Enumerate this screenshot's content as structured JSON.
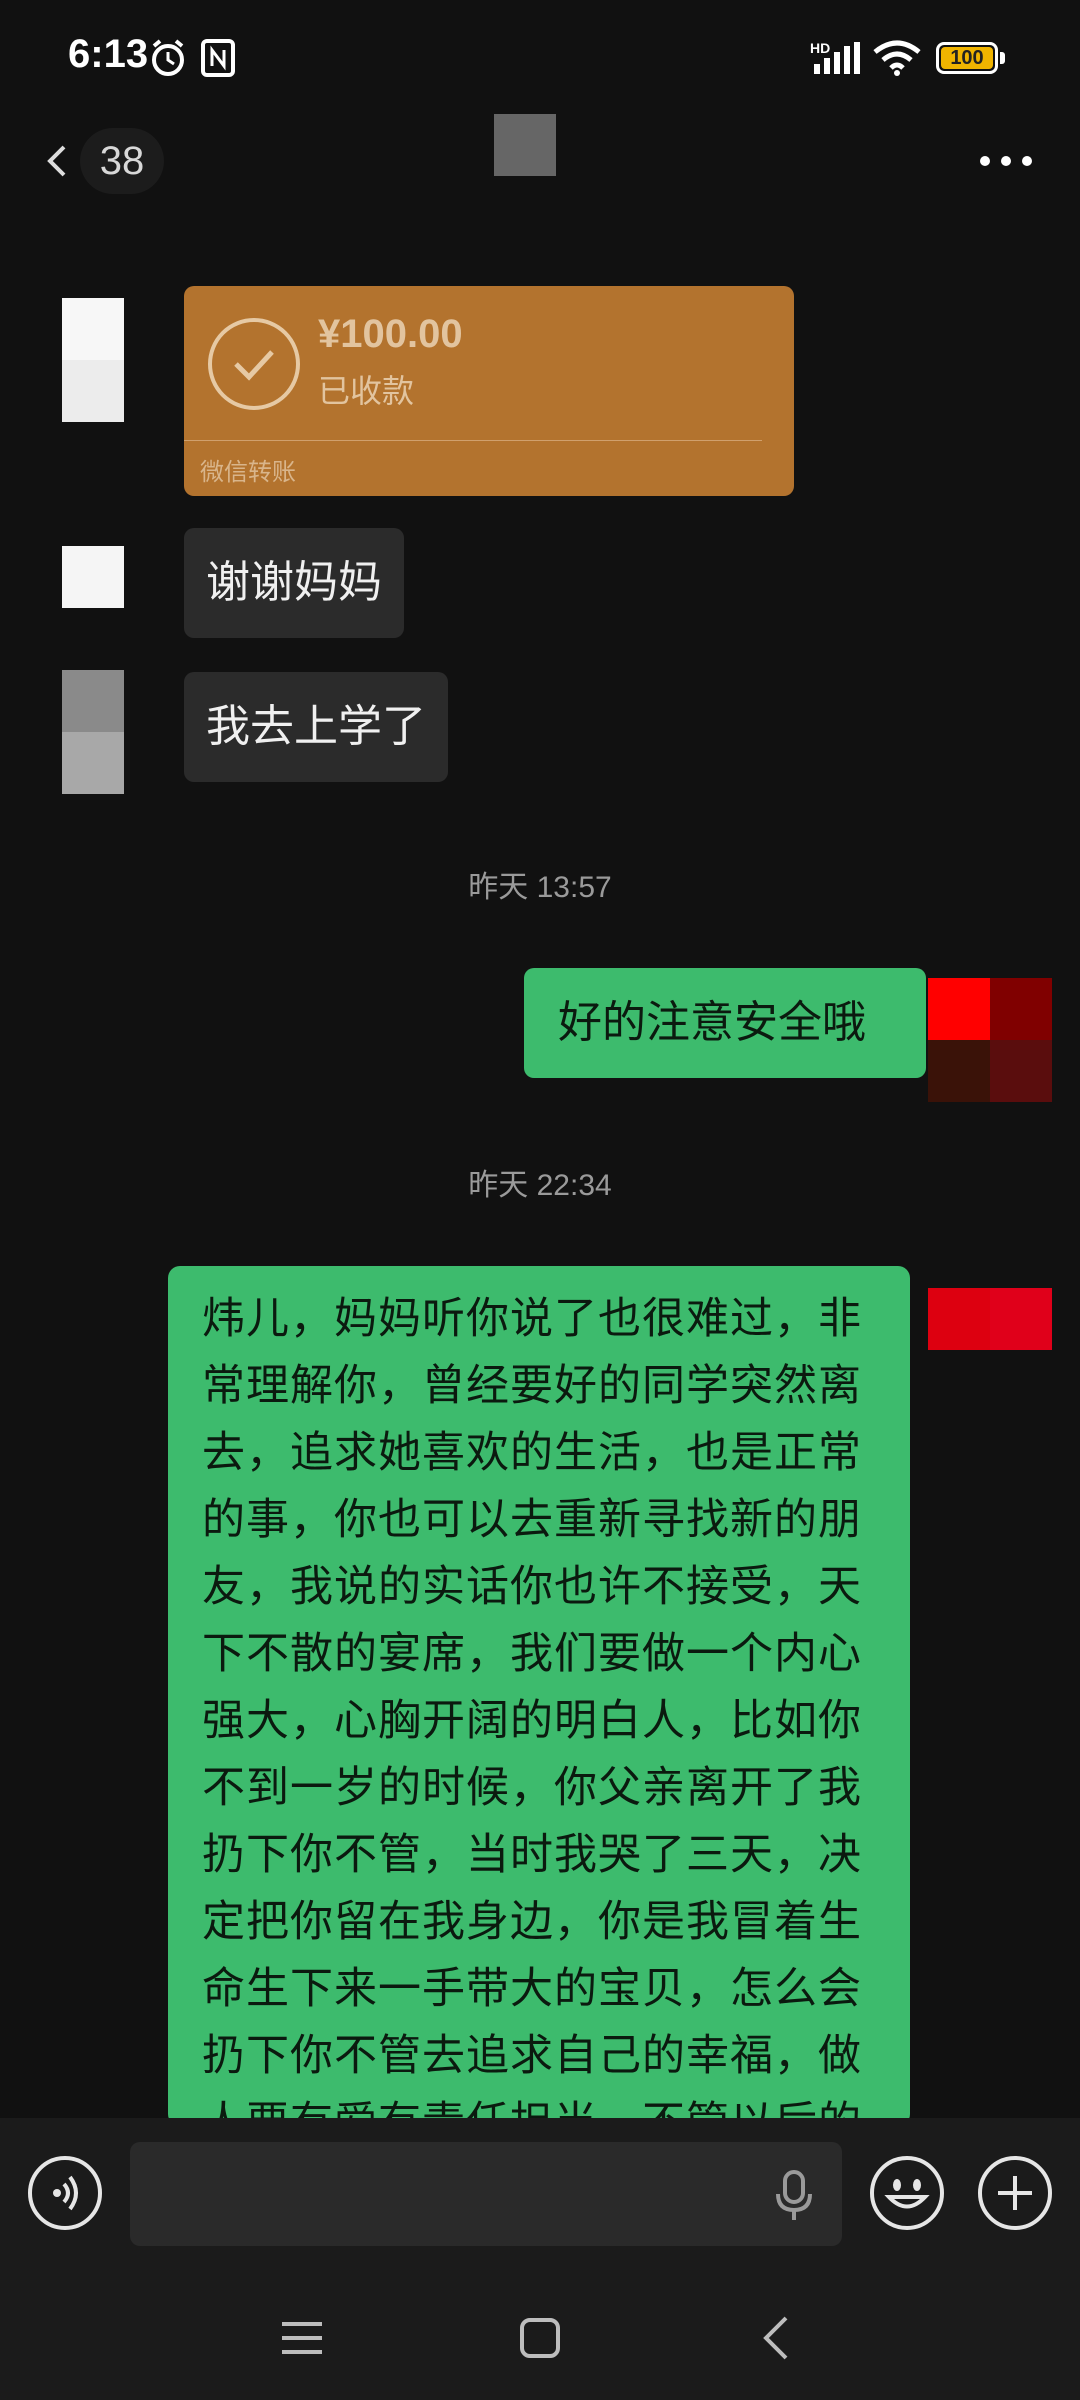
{
  "status_bar": {
    "time": "6:13",
    "network": "HD",
    "battery": "100"
  },
  "header": {
    "unread_count": "38"
  },
  "messages": {
    "transfer": {
      "amount": "¥100.00",
      "status": "已收款",
      "brand": "微信转账"
    },
    "incoming_1": "谢谢妈妈",
    "incoming_2": "我去上学了",
    "timestamp_1": "昨天 13:57",
    "outgoing_1": "好的注意安全哦",
    "timestamp_2": "昨天 22:34",
    "outgoing_long": "炜儿，妈妈听你说了也很难过，非常理解你，曾经要好的同学突然离去，追求她喜欢的生活，也是正常的事，你也可以去重新寻找新的朋友，我说的实话你也许不接受，天下不散的宴席，我们要做一个内心强大，心胸开阔的明白人，比如你不到一岁的时候，你父亲离开了我扔下你不管，当时我哭了三天，决定把你留在我身边，你是我冒着生命生下来一手带大的宝贝，怎么会扔下你不管去追求自己的幸福，做人要有爱有责任担当，不管以后的"
  },
  "input_bar": {
    "text": ""
  },
  "colors": {
    "background": "#111111",
    "outgoing_bubble": "#3dbb6d",
    "incoming_bubble": "#2b2b2b",
    "transfer_card": "#b3732e"
  },
  "icons": [
    "alarm-icon",
    "nfc-icon",
    "signal-icon",
    "wifi-icon",
    "battery-icon",
    "back-icon",
    "more-icon",
    "voice-icon",
    "mic-icon",
    "emoji-icon",
    "plus-icon",
    "menu-icon",
    "home-icon",
    "nav-back-icon"
  ]
}
